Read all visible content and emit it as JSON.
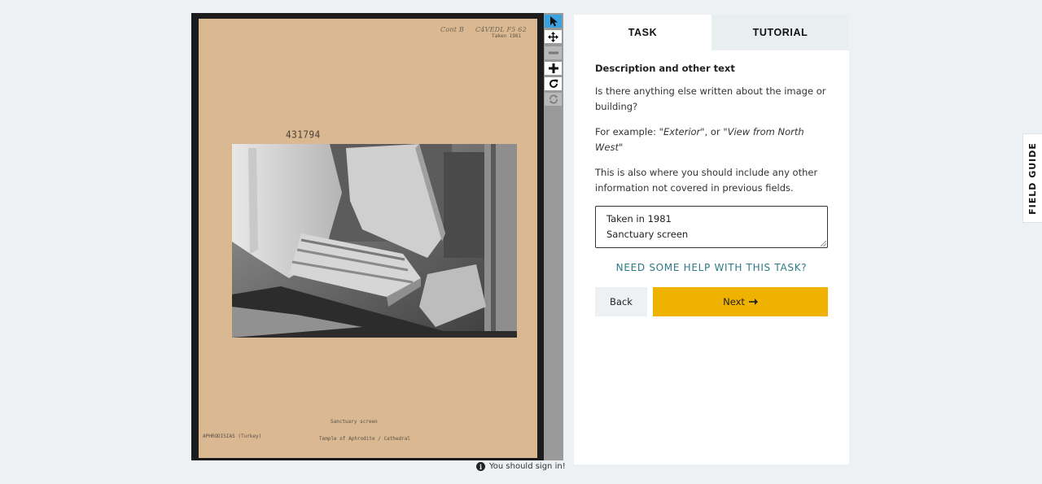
{
  "viewer": {
    "card_marks": {
      "hand_left": "Cont B",
      "hand_right": "C4VEDL F5 62",
      "taken": "Taken 1981",
      "accession": "431794",
      "caption_center": "Sanctuary screen",
      "caption_left": "APHRODISIAS (Turkey)",
      "caption_right": "Temple of Aphrodite / Cathedral"
    },
    "tools": [
      {
        "icon": "pointer-icon",
        "state": "active"
      },
      {
        "icon": "move-icon",
        "state": "normal"
      },
      {
        "icon": "zoom-out-icon",
        "state": "disabled"
      },
      {
        "icon": "zoom-in-icon",
        "state": "normal"
      },
      {
        "icon": "rotate-icon",
        "state": "normal"
      },
      {
        "icon": "reset-icon",
        "state": "disabled"
      }
    ],
    "signin_notice": "You should sign in!"
  },
  "panel": {
    "tabs": [
      {
        "label": "TASK",
        "active": true
      },
      {
        "label": "TUTORIAL",
        "active": false
      }
    ],
    "section_title": "Description and other text",
    "question": "Is there anything else written about the image or building?",
    "example_prefix": "For example: ",
    "example_1": "\"Exterior\"",
    "example_sep": ", or ",
    "example_2": "\"View from North West\"",
    "instruction": "This is also where you should include any other information not covered in previous fields.",
    "answer_lines": [
      "Taken in 1981",
      "Sanctuary screen"
    ],
    "help_link": "NEED SOME HELP WITH THIS TASK?",
    "back_label": "Back",
    "next_label": "Next"
  },
  "field_guide_label": "FIELD GUIDE",
  "colors": {
    "accent": "#f0b200",
    "help_link": "#2b7a86",
    "tool_active": "#3aa2e0"
  }
}
